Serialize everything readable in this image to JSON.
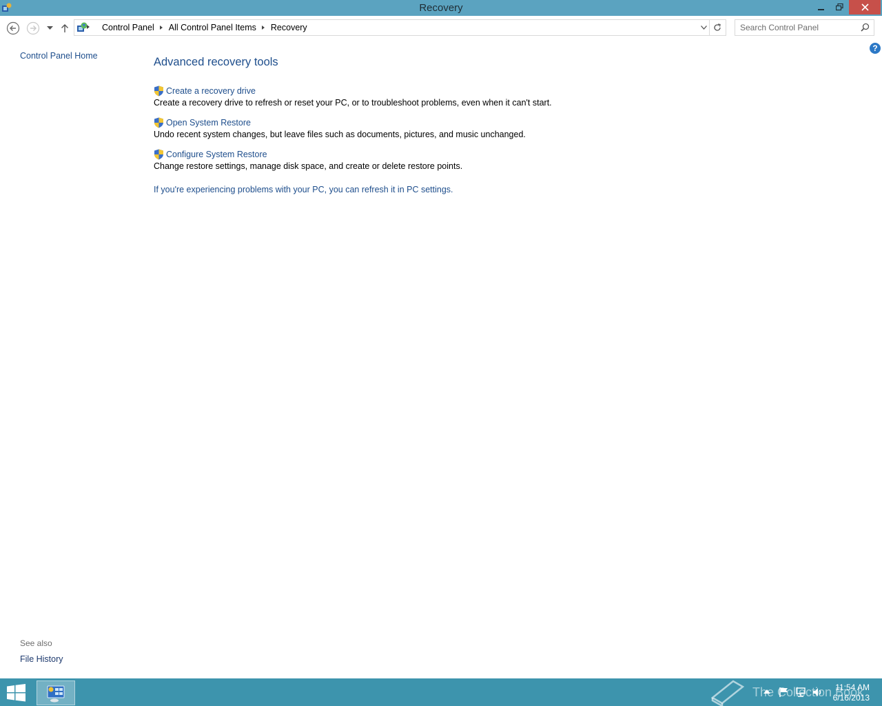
{
  "window": {
    "title": "Recovery"
  },
  "address_bar": {
    "crumbs": [
      "Control Panel",
      "All Control Panel Items",
      "Recovery"
    ]
  },
  "search": {
    "placeholder": "Search Control Panel"
  },
  "left_pane": {
    "home_link": "Control Panel Home",
    "see_also_label": "See also",
    "see_also_items": [
      "File History"
    ]
  },
  "main": {
    "heading": "Advanced recovery tools",
    "tasks": [
      {
        "label": "Create a recovery drive",
        "description": "Create a recovery drive to refresh or reset your PC, or to troubleshoot problems, even when it can't start."
      },
      {
        "label": "Open System Restore",
        "description": "Undo recent system changes, but leave files such as documents, pictures, and music unchanged."
      },
      {
        "label": "Configure System Restore",
        "description": "Change restore settings, manage disk space, and create or delete restore points."
      }
    ],
    "refresh_link": "If you're experiencing problems with your PC, you can refresh it in PC settings."
  },
  "taskbar": {
    "watermark": "The Collection Book",
    "clock_time": "11:54 AM",
    "clock_date": "6/16/2013"
  },
  "colors": {
    "titlebar": "#5ba3c0",
    "taskbar": "#3d94ad",
    "link": "#1e4e8c",
    "close_button": "#c7504a"
  },
  "icons": [
    "control-panel-icon",
    "minimize-icon",
    "restore-icon",
    "close-icon",
    "back-icon",
    "forward-icon",
    "recent-locations-icon",
    "up-icon",
    "location-icon",
    "refresh-icon",
    "search-icon",
    "help-icon",
    "uac-shield-icon",
    "windows-logo-icon",
    "book-icon",
    "show-hidden-icons",
    "flag-icon",
    "network-icon",
    "volume-icon"
  ]
}
